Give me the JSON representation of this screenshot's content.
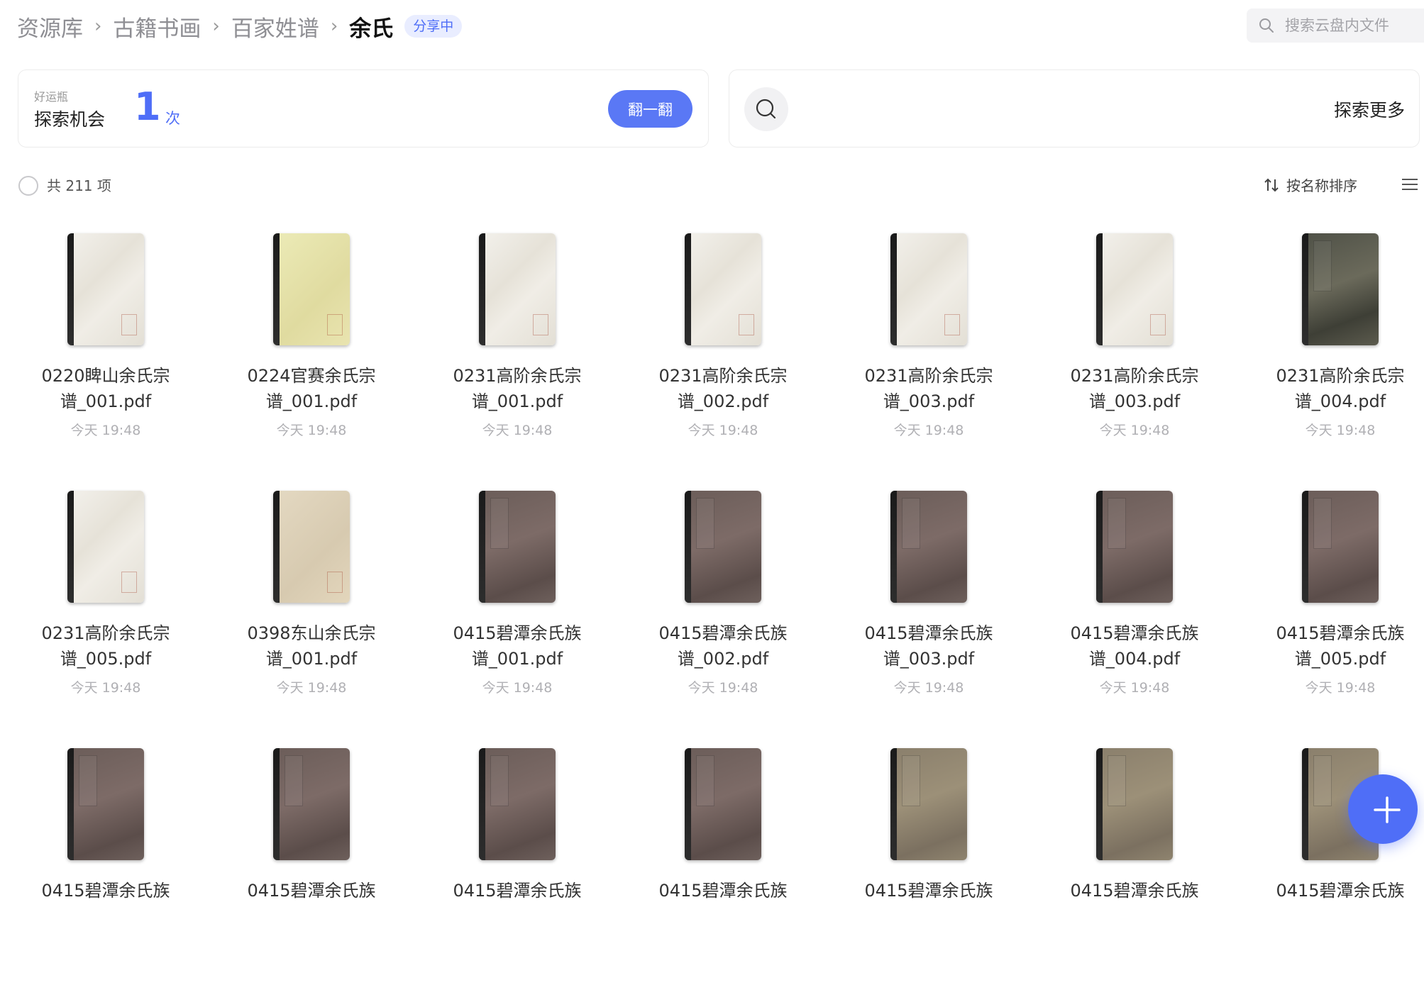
{
  "breadcrumb": {
    "items": [
      "资源库",
      "古籍书画",
      "百家姓谱"
    ],
    "current": "余氏",
    "badge": "分享中"
  },
  "search": {
    "placeholder": "搜索云盘内文件"
  },
  "lucky": {
    "small_label": "好运瓶",
    "main_label": "探索机会",
    "count": "1",
    "unit": "次",
    "button_label": "翻一翻"
  },
  "explore": {
    "label": "探索更多"
  },
  "toolbar": {
    "total": "共 211 项",
    "sort_label": "按名称排序"
  },
  "files": [
    {
      "name_line1": "0220睥山余氏宗",
      "name_line2": "谱_001.pdf",
      "date": "今天 19:48",
      "thumb": "paper"
    },
    {
      "name_line1": "0224官赛余氏宗",
      "name_line2": "谱_001.pdf",
      "date": "今天 19:48",
      "thumb": "yellow"
    },
    {
      "name_line1": "0231高阶余氏宗",
      "name_line2": "谱_001.pdf",
      "date": "今天 19:48",
      "thumb": "paper"
    },
    {
      "name_line1": "0231高阶余氏宗",
      "name_line2": "谱_002.pdf",
      "date": "今天 19:48",
      "thumb": "paper"
    },
    {
      "name_line1": "0231高阶余氏宗",
      "name_line2": "谱_003.pdf",
      "date": "今天 19:48",
      "thumb": "paper"
    },
    {
      "name_line1": "0231高阶余氏宗",
      "name_line2": "谱_003.pdf",
      "date": "今天 19:48",
      "thumb": "paper"
    },
    {
      "name_line1": "0231高阶余氏宗",
      "name_line2": "谱_004.pdf",
      "date": "今天 19:48",
      "thumb": "dark"
    },
    {
      "name_line1": "0231高阶余氏宗",
      "name_line2": "谱_005.pdf",
      "date": "今天 19:48",
      "thumb": "paper"
    },
    {
      "name_line1": "0398东山余氏宗",
      "name_line2": "谱_001.pdf",
      "date": "今天 19:48",
      "thumb": "beige"
    },
    {
      "name_line1": "0415碧潭余氏族",
      "name_line2": "谱_001.pdf",
      "date": "今天 19:48",
      "thumb": "brown"
    },
    {
      "name_line1": "0415碧潭余氏族",
      "name_line2": "谱_002.pdf",
      "date": "今天 19:48",
      "thumb": "brown"
    },
    {
      "name_line1": "0415碧潭余氏族",
      "name_line2": "谱_003.pdf",
      "date": "今天 19:48",
      "thumb": "brown"
    },
    {
      "name_line1": "0415碧潭余氏族",
      "name_line2": "谱_004.pdf",
      "date": "今天 19:48",
      "thumb": "brown"
    },
    {
      "name_line1": "0415碧潭余氏族",
      "name_line2": "谱_005.pdf",
      "date": "今天 19:48",
      "thumb": "brown"
    },
    {
      "name_line1": "0415碧潭余氏族",
      "name_line2": "",
      "date": "",
      "thumb": "brown"
    },
    {
      "name_line1": "0415碧潭余氏族",
      "name_line2": "",
      "date": "",
      "thumb": "brown"
    },
    {
      "name_line1": "0415碧潭余氏族",
      "name_line2": "",
      "date": "",
      "thumb": "brown"
    },
    {
      "name_line1": "0415碧潭余氏族",
      "name_line2": "",
      "date": "",
      "thumb": "brown"
    },
    {
      "name_line1": "0415碧潭余氏族",
      "name_line2": "",
      "date": "",
      "thumb": "brown2"
    },
    {
      "name_line1": "0415碧潭余氏族",
      "name_line2": "",
      "date": "",
      "thumb": "brown2"
    },
    {
      "name_line1": "0415碧潭余氏族",
      "name_line2": "",
      "date": "",
      "thumb": "brown2"
    }
  ],
  "icons": {
    "search": "search-icon",
    "sort": "sort-arrows-icon",
    "menu": "list-menu-icon",
    "add": "plus-icon"
  },
  "colors": {
    "accent": "#4f6ef7",
    "badge_bg": "#e9edff",
    "muted_text": "#8e8e93"
  }
}
